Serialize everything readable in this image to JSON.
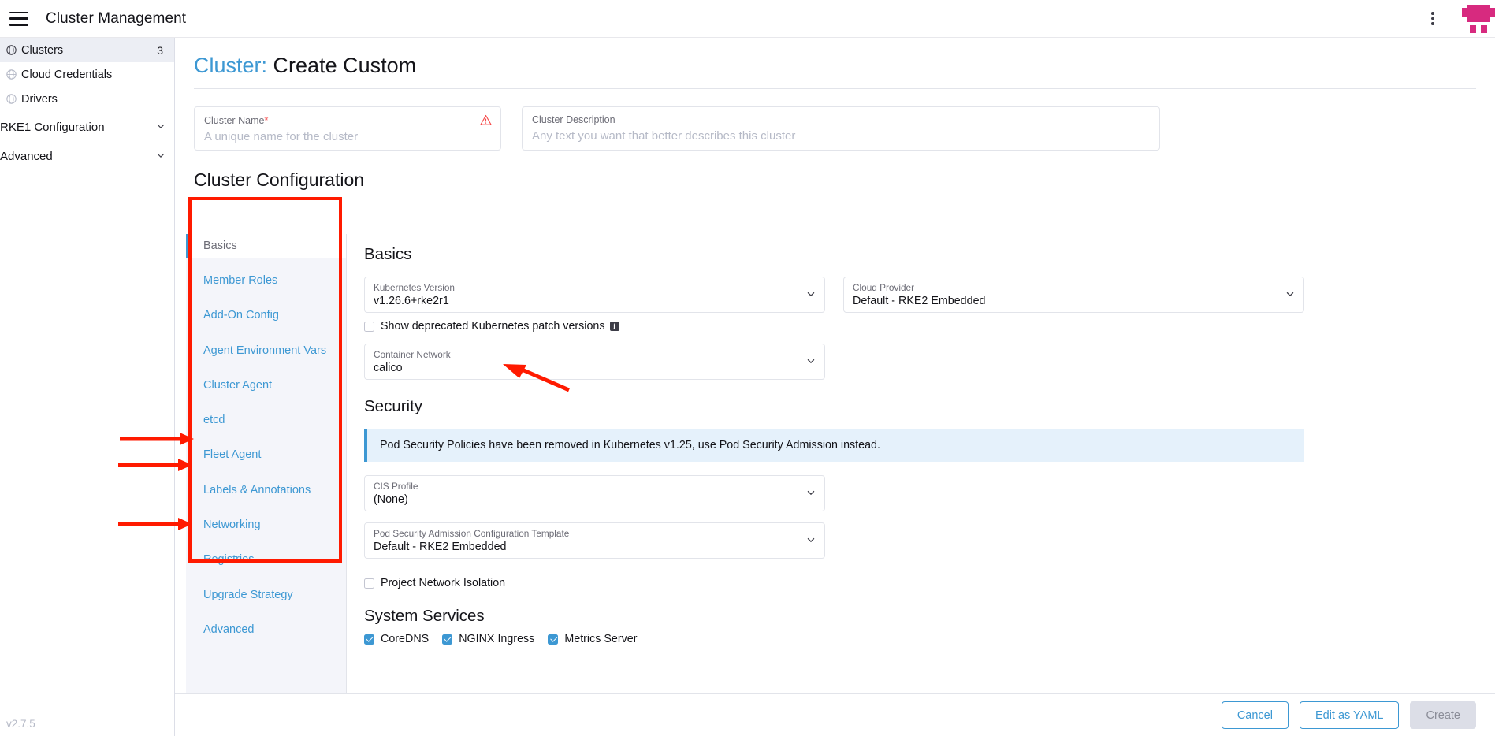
{
  "topbar": {
    "menu_icon": "hamburger-icon",
    "title": "Cluster Management",
    "kebab_icon": "kebab-menu-icon",
    "logo_icon": "rancher-logo-icon"
  },
  "sidebar": {
    "items": [
      {
        "label": "Clusters",
        "count": "3",
        "icon": "globe-icon",
        "active": true
      },
      {
        "label": "Cloud Credentials",
        "count": "",
        "icon": "globe-icon",
        "active": false
      },
      {
        "label": "Drivers",
        "count": "",
        "icon": "globe-icon",
        "active": false
      }
    ],
    "groups": [
      {
        "label": "RKE1 Configuration",
        "icon": "chevron-down-icon"
      },
      {
        "label": "Advanced",
        "icon": "chevron-down-icon"
      }
    ],
    "version": "v2.7.5"
  },
  "page": {
    "title_prefix": "Cluster:",
    "title_main": "Create Custom",
    "section_title": "Cluster Configuration"
  },
  "name_form": {
    "cluster_name": {
      "label": "Cluster Name",
      "required_mark": "*",
      "placeholder": "A unique name for the cluster",
      "warning_icon": "warning-triangle-icon"
    },
    "cluster_description": {
      "label": "Cluster Description",
      "placeholder": "Any text you want that better describes this cluster"
    }
  },
  "config": {
    "tabs": [
      {
        "label": "Basics",
        "active": true
      },
      {
        "label": "Member Roles",
        "active": false
      },
      {
        "label": "Add-On Config",
        "active": false
      },
      {
        "label": "Agent Environment Vars",
        "active": false
      },
      {
        "label": "Cluster Agent",
        "active": false
      },
      {
        "label": "etcd",
        "active": false
      },
      {
        "label": "Fleet Agent",
        "active": false
      },
      {
        "label": "Labels & Annotations",
        "active": false
      },
      {
        "label": "Networking",
        "active": false
      },
      {
        "label": "Registries",
        "active": false
      },
      {
        "label": "Upgrade Strategy",
        "active": false
      },
      {
        "label": "Advanced",
        "active": false
      }
    ],
    "basics": {
      "heading": "Basics",
      "kubernetes_version": {
        "label": "Kubernetes Version",
        "value": "v1.26.6+rke2r1",
        "icon": "chevron-down-icon"
      },
      "cloud_provider": {
        "label": "Cloud Provider",
        "value": "Default - RKE2 Embedded",
        "icon": "chevron-down-icon"
      },
      "show_deprecated": {
        "label": "Show deprecated Kubernetes patch versions",
        "checked": false,
        "info_icon": "info-icon",
        "info_glyph": "i"
      },
      "container_network": {
        "label": "Container Network",
        "value": "calico",
        "icon": "chevron-down-icon"
      }
    },
    "security": {
      "heading": "Security",
      "banner": "Pod Security Policies have been removed in Kubernetes v1.25, use Pod Security Admission instead.",
      "cis_profile": {
        "label": "CIS Profile",
        "value": "(None)",
        "icon": "chevron-down-icon"
      },
      "psa_template": {
        "label": "Pod Security Admission Configuration Template",
        "value": "Default - RKE2 Embedded",
        "icon": "chevron-down-icon"
      },
      "project_network_isolation": {
        "label": "Project Network Isolation",
        "checked": false
      }
    },
    "system_services": {
      "heading": "System Services",
      "items": [
        {
          "label": "CoreDNS",
          "checked": true
        },
        {
          "label": "NGINX Ingress",
          "checked": true
        },
        {
          "label": "Metrics Server",
          "checked": true
        }
      ]
    }
  },
  "footer": {
    "cancel": "Cancel",
    "edit_yaml": "Edit as YAML",
    "create": "Create"
  },
  "colors": {
    "accent_blue": "#3d98d3",
    "brand_pink": "#d72a7f",
    "annotation_red": "#ff1a00",
    "banner_bg": "#e5f1fb",
    "required_red": "#f64747"
  }
}
